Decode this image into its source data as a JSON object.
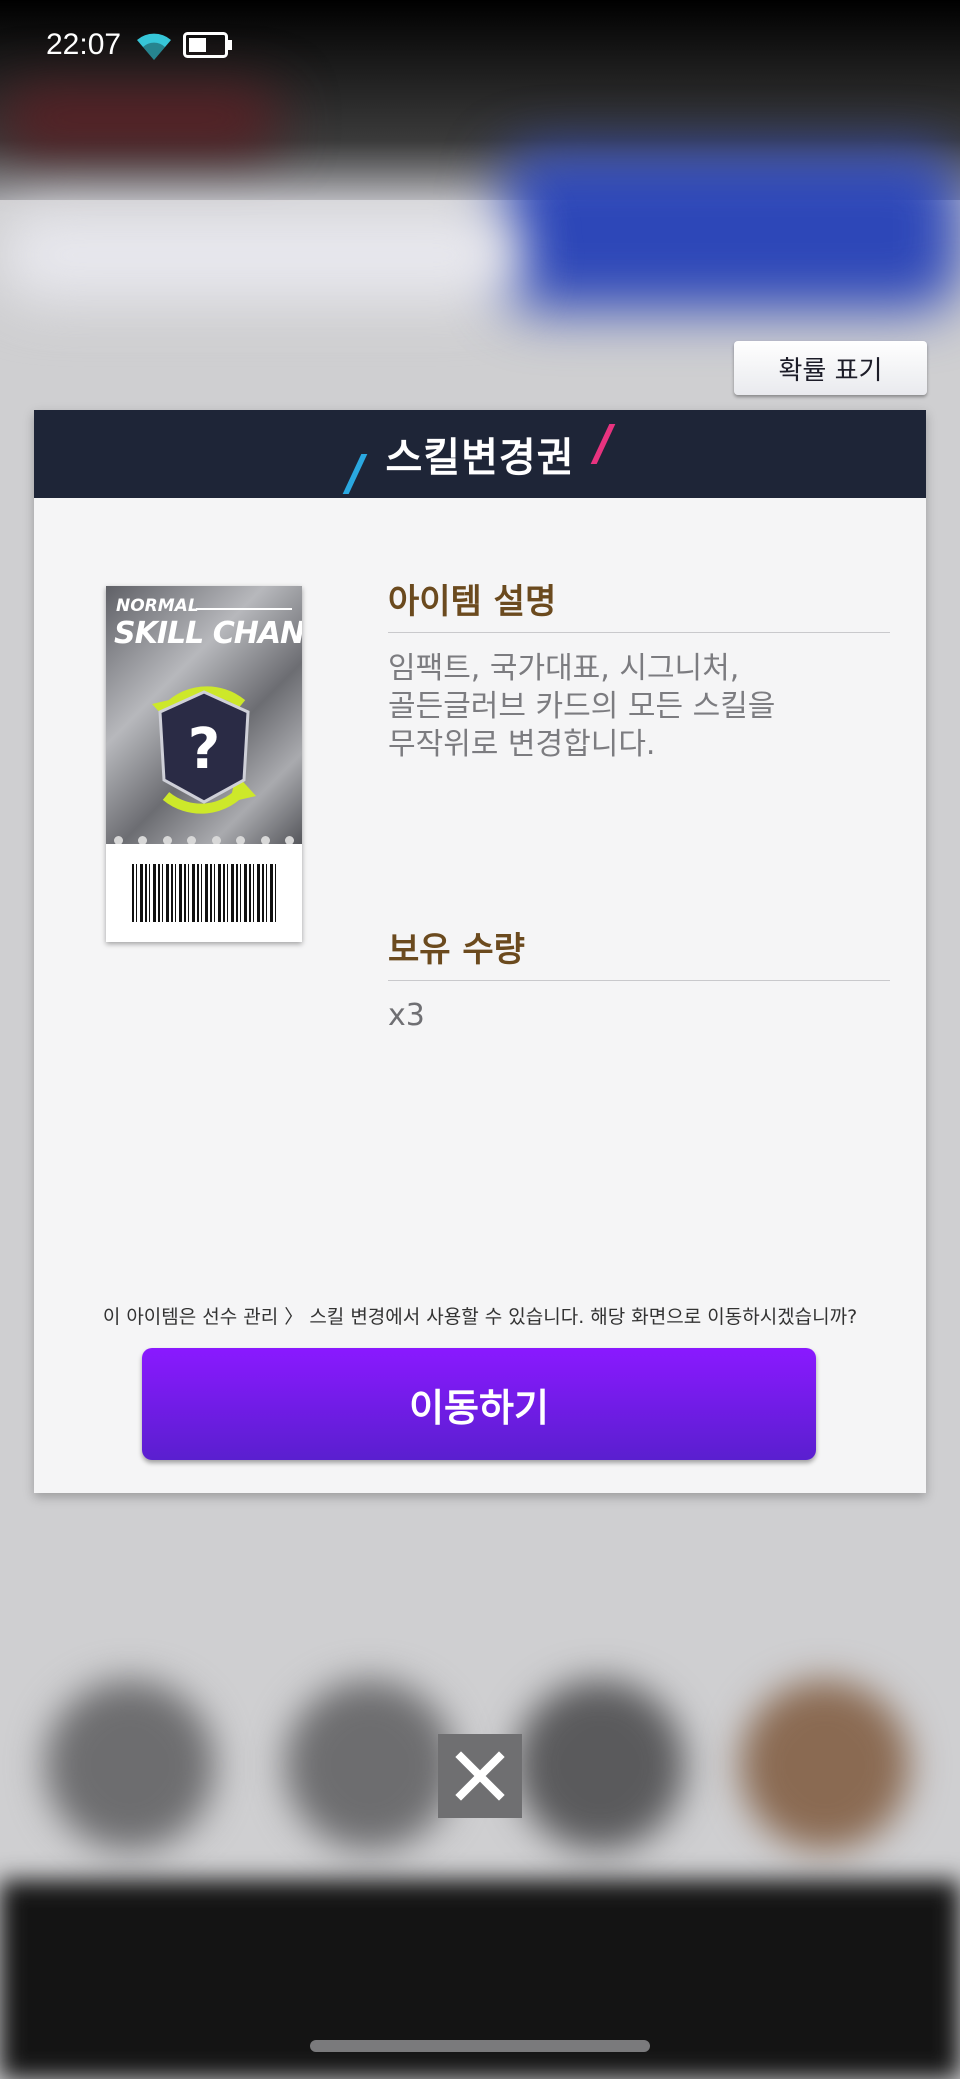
{
  "status_bar": {
    "time": "22:07"
  },
  "probability_button": "확률 표기",
  "modal": {
    "title": "스킬변경권",
    "card": {
      "top_text": "NORMAL",
      "main_text": "SKILL CHANGE",
      "emblem_symbol": "?"
    },
    "description_title": "아이템 설명",
    "description_lines": [
      "임팩트, 국가대표, 시그니처,",
      "골든글러브 카드의 모든 스킬을",
      "무작위로 변경합니다."
    ],
    "quantity_title": "보유 수량",
    "quantity_value": "x3",
    "notice": "이 아이템은 선수 관리 〉 스킬 변경에서 사용할 수 있습니다. 해당 화면으로 이동하시겠습니까?",
    "go_button": "이동하기"
  },
  "colors": {
    "header_bg": "#1e2537",
    "accent_purple": "#7a1cf0",
    "section_title": "#6b4a1e",
    "slash_cyan": "#2aa8e0",
    "slash_pink": "#e8337f"
  },
  "icons": {
    "wifi": "wifi-icon",
    "battery": "battery-icon",
    "close": "close-icon"
  }
}
